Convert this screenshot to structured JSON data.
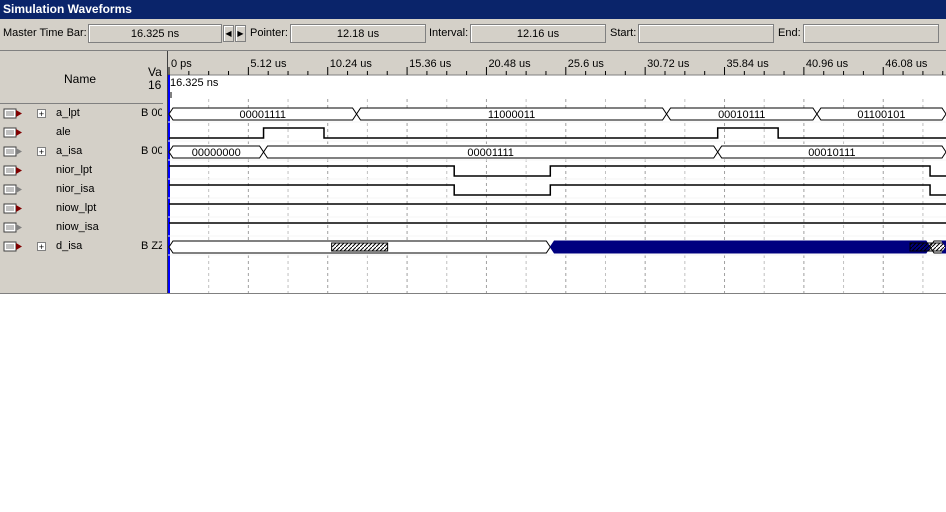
{
  "window": {
    "title": "Simulation Waveforms"
  },
  "toolbar": {
    "master_label": "Master Time Bar:",
    "master_value": "16.325 ns",
    "pointer_label": "Pointer:",
    "pointer_value": "12.18 us",
    "interval_label": "Interval:",
    "interval_value": "12.16 us",
    "start_label": "Start:",
    "start_value": "",
    "end_label": "End:",
    "end_value": "",
    "spin_left": "◀",
    "spin_right": "▶"
  },
  "columns": {
    "name": "Name",
    "value_header_line1": "Va",
    "value_header_line2": "16"
  },
  "time_axis": {
    "ticks": [
      "0 ps",
      "5.12 us",
      "10.24 us",
      "15.36 us",
      "20.48 us",
      "25.6 us",
      "30.72 us",
      "35.84 us",
      "40.96 us",
      "46.08 us"
    ],
    "cursor_label": "16.325 ns"
  },
  "signals": [
    {
      "name": "a_lpt",
      "value": "B 00",
      "icon": "input-pin-icon",
      "expandable": true,
      "kind": "bus",
      "segments": [
        [
          "00001111",
          0,
          12.1
        ],
        [
          "11000011",
          12.1,
          32.1
        ],
        [
          "00010111",
          32.1,
          41.8
        ],
        [
          "01100101",
          41.8,
          60
        ]
      ]
    },
    {
      "name": "ale",
      "value": "",
      "icon": "input-pin-icon",
      "expandable": false,
      "kind": "bit",
      "transitions": [
        [
          0,
          0
        ],
        [
          6.1,
          1
        ],
        [
          10.0,
          0
        ],
        [
          35.4,
          1
        ],
        [
          39.3,
          0
        ]
      ]
    },
    {
      "name": "a_isa",
      "value": "B 00",
      "icon": "output-pin-icon",
      "expandable": true,
      "kind": "bus",
      "segments": [
        [
          "00000000",
          0,
          6.1
        ],
        [
          "00001111",
          6.1,
          35.4
        ],
        [
          "00010111",
          35.4,
          60
        ]
      ]
    },
    {
      "name": "nior_lpt",
      "value": "",
      "icon": "input-pin-icon",
      "expandable": false,
      "kind": "bit",
      "transitions": [
        [
          0,
          1
        ],
        [
          18.4,
          0
        ],
        [
          24.6,
          1
        ],
        [
          49.1,
          0
        ],
        [
          55.2,
          1
        ]
      ]
    },
    {
      "name": "nior_isa",
      "value": "",
      "icon": "output-pin-icon",
      "expandable": false,
      "kind": "bit",
      "transitions": [
        [
          0,
          1
        ],
        [
          18.4,
          0
        ],
        [
          24.6,
          1
        ],
        [
          49.1,
          0
        ],
        [
          55.2,
          1
        ]
      ]
    },
    {
      "name": "niow_lpt",
      "value": "",
      "icon": "input-pin-icon",
      "expandable": false,
      "kind": "bit",
      "transitions": [
        [
          0,
          1
        ]
      ]
    },
    {
      "name": "niow_isa",
      "value": "",
      "icon": "output-pin-icon",
      "expandable": false,
      "kind": "bit",
      "transitions": [
        [
          0,
          1
        ]
      ]
    },
    {
      "name": "d_isa",
      "value": "B ZZ",
      "icon": "bidir-pin-icon",
      "expandable": true,
      "kind": "bus",
      "segments": [
        [
          "Z",
          0,
          24.6
        ],
        [
          "FILL",
          24.6,
          49.1
        ],
        [
          "Z",
          49.1,
          55.2
        ],
        [
          "FILL",
          55.2,
          60
        ]
      ]
    }
  ],
  "colors": {
    "bus_fill": "#00007f",
    "title_bg": "#0a246a",
    "panel": "#d4d0c8",
    "cursor": "#0000ff"
  }
}
